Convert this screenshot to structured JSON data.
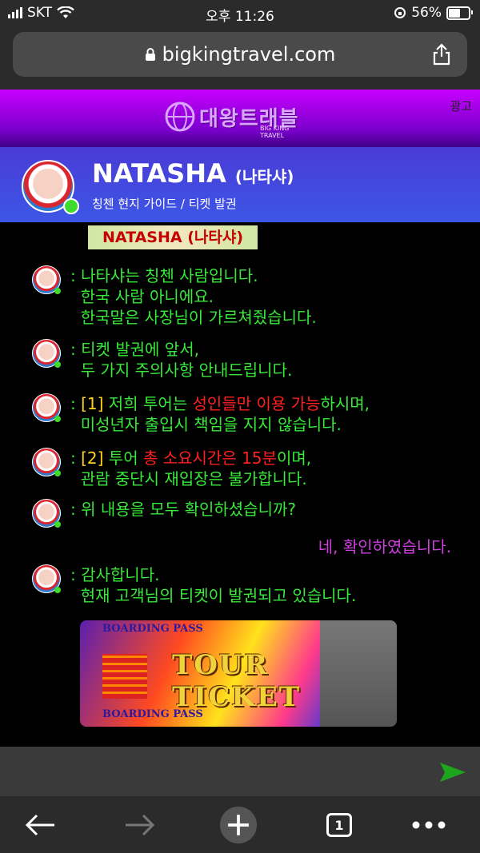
{
  "status_bar": {
    "carrier": "SKT",
    "time": "오후 11:26",
    "battery": "56%"
  },
  "browser": {
    "url": "bigkingtravel.com"
  },
  "banner": {
    "logo_text": "대왕트래블",
    "logo_sub": "BIG KING TRAVEL",
    "ad_label": "광고"
  },
  "profile": {
    "name": "NATASHA",
    "name_kr": "(나타샤)",
    "role": "칭첸 현지 가이드 / 티켓 발권"
  },
  "chat": {
    "name_image_text": "NATASHA (나타샤)",
    "messages": [
      {
        "line1": ": 나타샤는 칭첸 사람입니다.",
        "line2": "  한국 사람 아니에요.",
        "line3": "  한국말은 사장님이 가르쳐줬습니다."
      },
      {
        "line1": ": 티켓 발권에 앞서,",
        "line2": "  두 가지 주의사항 안내드립니다."
      },
      {
        "prefix": ": ",
        "num": "[1]",
        "a": " 저희 투어는 ",
        "red": "성인들만 이용 가능",
        "b": "하시며,",
        "line2": "  미성년자 출입시 책임을 지지 않습니다."
      },
      {
        "prefix": ": ",
        "num": "[2]",
        "a": " 투어 ",
        "red": "총 소요시간은 15분",
        "b": "이며,",
        "line2": "  관람 중단시 재입장은 불가합니다."
      },
      {
        "line1": ": 위 내용을 모두 확인하셨습니까?"
      },
      {
        "line1": ": 감사합니다.",
        "line2": "  현재 고객님의 티켓이 발권되고 있습니다."
      }
    ],
    "reply": "네, 확인하였습니다.",
    "ticket": {
      "top": "BOARDING PASS",
      "title": "TOUR TICKET",
      "bottom": "BOARDING PASS"
    }
  },
  "toolbar": {
    "tab_count": "1"
  },
  "colors": {
    "chat_text": "#38e83a",
    "highlight": "#ff2020",
    "number": "#ffd21c",
    "reply": "#d040e0"
  }
}
